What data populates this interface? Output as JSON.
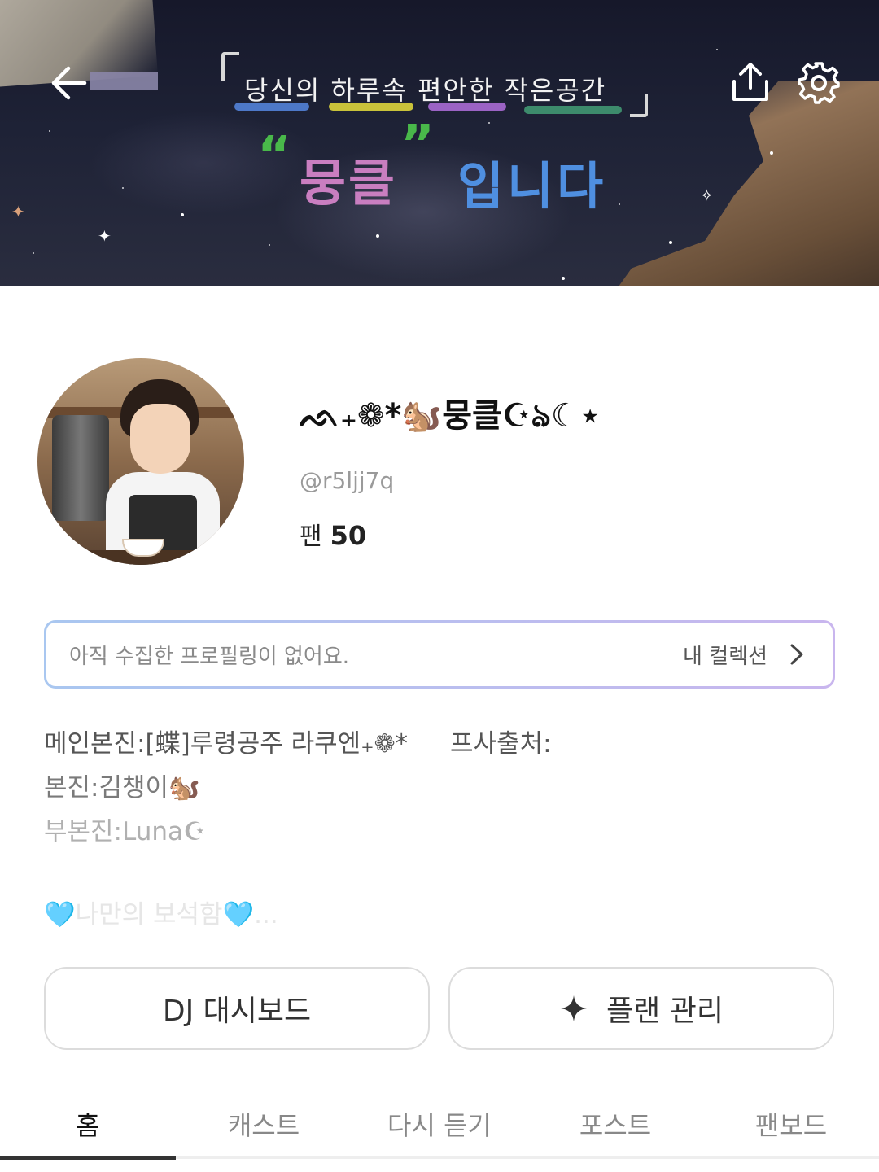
{
  "banner": {
    "line1": "당신의 하루속 편안한 작은공간",
    "open_quote": "“",
    "close_quote": "”",
    "word": "뭉클",
    "word2": "입니다"
  },
  "header": {
    "back_icon": "arrow-left-icon",
    "share_icon": "share-upload-icon",
    "settings_icon": "gear-icon"
  },
  "profile": {
    "display_name": "ᨒ₊❁*🐿️뭉클☪︎ঌ☾⋆",
    "handle": "@r5ljj7q",
    "fans_label": "팬",
    "fans_count": "50"
  },
  "collection": {
    "empty_text": "아직 수집한 프로필링이 없어요.",
    "link_label": "내 컬렉션"
  },
  "bio": {
    "line1": "메인본진:[蝶]루령공주 라쿠엔₊❁*",
    "line1_extra": "프사출처:",
    "line2": "본진:김챙이🐿️",
    "line3": "부본진:Luna☪︎",
    "line4": "🩵나만의 보석함🩵..."
  },
  "buttons": {
    "dashboard": "DJ 대시보드",
    "plan": "플랜 관리"
  },
  "tabs": [
    {
      "label": "홈"
    },
    {
      "label": "캐스트"
    },
    {
      "label": "다시 듣기"
    },
    {
      "label": "포스트"
    },
    {
      "label": "팬보드"
    }
  ],
  "colors": {
    "accent_border_start": "#a9c7f0",
    "accent_border_end": "#c9b6ee",
    "tab_indicator": "#333333"
  }
}
